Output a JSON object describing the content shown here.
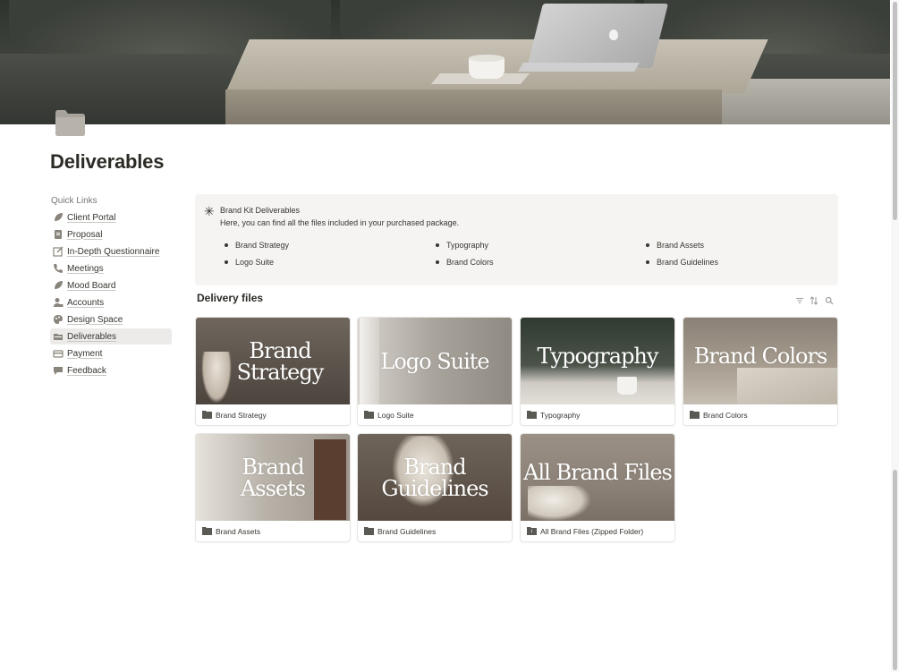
{
  "page": {
    "title": "Deliverables",
    "icon": "folder-icon"
  },
  "quick_links": {
    "heading": "Quick Links",
    "items": [
      {
        "label": "Client Portal",
        "icon": "leaf-icon"
      },
      {
        "label": "Proposal",
        "icon": "document-icon"
      },
      {
        "label": "In-Depth Questionnaire",
        "icon": "edit-icon"
      },
      {
        "label": "Meetings",
        "icon": "phone-icon"
      },
      {
        "label": "Mood Board",
        "icon": "leaf-icon"
      },
      {
        "label": "Accounts",
        "icon": "user-lock-icon"
      },
      {
        "label": "Design Space",
        "icon": "palette-icon"
      },
      {
        "label": "Deliverables",
        "icon": "folder-icon",
        "active": true
      },
      {
        "label": "Payment",
        "icon": "card-icon"
      },
      {
        "label": "Feedback",
        "icon": "chat-icon"
      }
    ]
  },
  "callout": {
    "icon": "asterisk-icon",
    "title": "Brand Kit Deliverables",
    "description": "Here, you can find all the files included in your purchased package.",
    "bullets": [
      "Brand Strategy",
      "Typography",
      "Brand Assets",
      "Logo Suite",
      "Brand Colors",
      "Brand Guidelines"
    ]
  },
  "gallery": {
    "title": "Delivery files",
    "tools": [
      "filter-icon",
      "sort-icon",
      "search-icon"
    ],
    "cards": [
      {
        "thumb_text": "Brand\nStrategy",
        "label": "Brand Strategy",
        "icon": "folder-icon"
      },
      {
        "thumb_text": "Logo Suite",
        "label": "Logo Suite",
        "icon": "folder-icon"
      },
      {
        "thumb_text": "Typography",
        "label": "Typography",
        "icon": "folder-icon"
      },
      {
        "thumb_text": "Brand Colors",
        "label": "Brand Colors",
        "icon": "folder-icon"
      },
      {
        "thumb_text": "Brand\nAssets",
        "label": "Brand Assets",
        "icon": "folder-icon"
      },
      {
        "thumb_text": "Brand\nGuidelines",
        "label": "Brand Guidelines",
        "icon": "folder-icon"
      },
      {
        "thumb_text": "All Brand Files",
        "label": "All Brand Files (Zipped Folder)",
        "icon": "folder-zip-icon"
      }
    ]
  },
  "colors": {
    "accent_bg": "#f5f4f2",
    "active_item_bg": "#ecebe9",
    "text": "#37352f"
  }
}
